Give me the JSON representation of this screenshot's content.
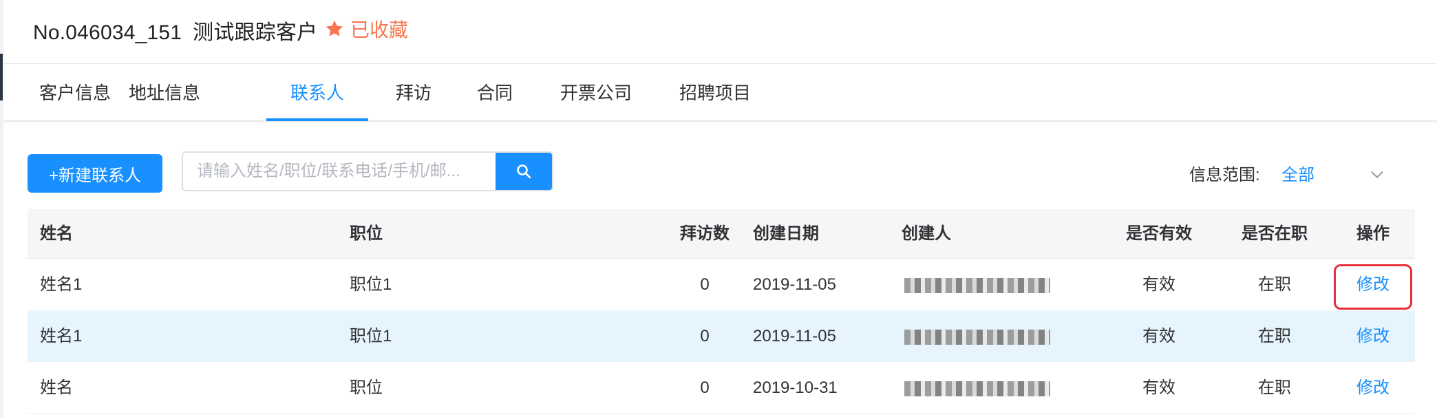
{
  "header": {
    "record_no": "No.046034_151",
    "customer_name": "测试跟踪客户",
    "favorite_label": "已收藏",
    "favorite_color": "#f6774e",
    "favorite_icon": "star-icon"
  },
  "tabs": [
    {
      "label": "客户信息"
    },
    {
      "label": "地址信息"
    },
    {
      "label": "联系人",
      "active": true
    },
    {
      "label": "拜访"
    },
    {
      "label": "合同"
    },
    {
      "label": "开票公司"
    },
    {
      "label": "招聘项目"
    }
  ],
  "toolbar": {
    "new_button_label": "+新建联系人",
    "search_placeholder": "请输入姓名/职位/联系电话/手机/邮...",
    "search_icon": "search-icon",
    "scope_label": "信息范围:",
    "scope_value": "全部",
    "scope_icon": "chevron-down-icon"
  },
  "table": {
    "columns": [
      "姓名",
      "职位",
      "拜访数",
      "创建日期",
      "创建人",
      "是否有效",
      "是否在职",
      "操作"
    ],
    "rows": [
      {
        "name": "姓名1",
        "position": "职位1",
        "visits": "0",
        "created_date": "2019-11-05",
        "valid": "有效",
        "employed": "在职",
        "action": "修改",
        "highlighted": false,
        "action_boxed": true
      },
      {
        "name": "姓名1",
        "position": "职位1",
        "visits": "0",
        "created_date": "2019-11-05",
        "valid": "有效",
        "employed": "在职",
        "action": "修改",
        "highlighted": true,
        "action_boxed": false
      },
      {
        "name": "姓名",
        "position": "职位",
        "visits": "0",
        "created_date": "2019-10-31",
        "valid": "有效",
        "employed": "在职",
        "action": "修改",
        "highlighted": false,
        "action_boxed": false
      }
    ]
  },
  "colors": {
    "accent": "#1890ff",
    "annotation_box": "#e5303b",
    "row_highlight": "#e6f4fd"
  }
}
